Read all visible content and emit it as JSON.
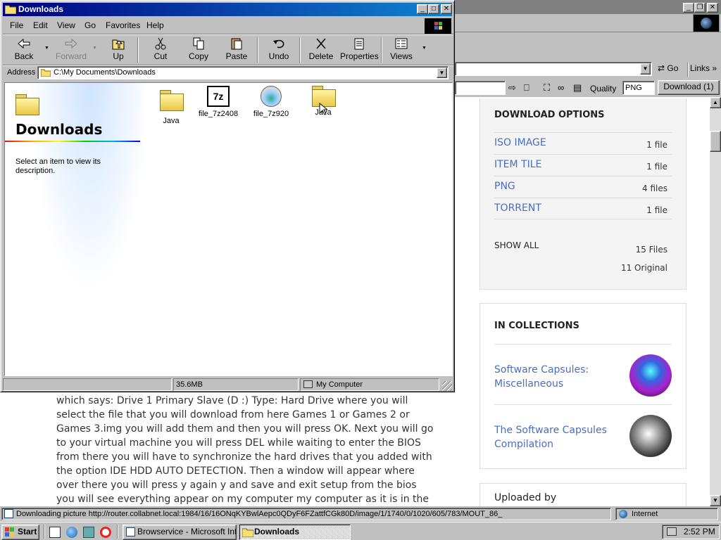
{
  "explorer": {
    "title": "Downloads",
    "menu": [
      "File",
      "Edit",
      "View",
      "Go",
      "Favorites",
      "Help"
    ],
    "toolbar": {
      "back": "Back",
      "forward": "Forward",
      "up": "Up",
      "cut": "Cut",
      "copy": "Copy",
      "paste": "Paste",
      "undo": "Undo",
      "delete": "Delete",
      "properties": "Properties",
      "views": "Views"
    },
    "address_label": "Address",
    "address_value": "C:\\My Documents\\Downloads",
    "sidebar": {
      "heading": "Downloads",
      "description": "Select an item to view its description."
    },
    "files": [
      {
        "name": "Java",
        "icon": "zip-folder-icon"
      },
      {
        "name": "file_7z2408",
        "icon": "7z-icon"
      },
      {
        "name": "file_7z920",
        "icon": "installer-icon"
      },
      {
        "name": "Java",
        "icon": "folder-icon"
      }
    ],
    "status": {
      "size": "35.6MB",
      "location": "My Computer"
    }
  },
  "browser": {
    "go_label": "Go",
    "links_label": "Links",
    "quality_label": "Quality",
    "quality_value": "PNG",
    "download_button": "Download (1)",
    "status_text": "Downloading picture http://router.collabnet.local:1984/16/16ONqKYBwlAepc0QDyF6FZattfCGk80D/image/1/1740/0/1020/605/783/MOUT_86_",
    "zone": "Internet"
  },
  "download_options": {
    "title": "DOWNLOAD OPTIONS",
    "rows": [
      {
        "label": "ISO IMAGE",
        "count": "1 file"
      },
      {
        "label": "ITEM TILE",
        "count": "1 file"
      },
      {
        "label": "PNG",
        "count": "4 files"
      },
      {
        "label": "TORRENT",
        "count": "1 file"
      }
    ],
    "show_all": "SHOW ALL",
    "total_files": "15 Files",
    "original": "11 Original"
  },
  "collections": {
    "title": "IN COLLECTIONS",
    "items": [
      {
        "label": "Software Capsules: Miscellaneous"
      },
      {
        "label": "The Software Capsules Compilation"
      }
    ]
  },
  "uploaded_by": "Uploaded by",
  "article": "which says: Drive 1 Primary Slave (D :) Type: Hard Drive where you will select the file that you will download from here Games 1 or Games 2 or Games 3.img you will add them and then you will press OK. Next you will go to your virtual machine you will press DEL while waiting to enter the BIOS from there you will have to synchronize the hard drives that you added with the option IDE HDD AUTO DETECTION. Then a window will appear where over there you will press y again y and save and exit setup from the bios you will see everything appear on my computer my computer as it is in the pictures above. In detail, the games contained",
  "taskbar": {
    "start": "Start",
    "tasks": [
      "Browservice - Microsoft Int...",
      "Downloads"
    ],
    "clock": "2:52 PM"
  }
}
